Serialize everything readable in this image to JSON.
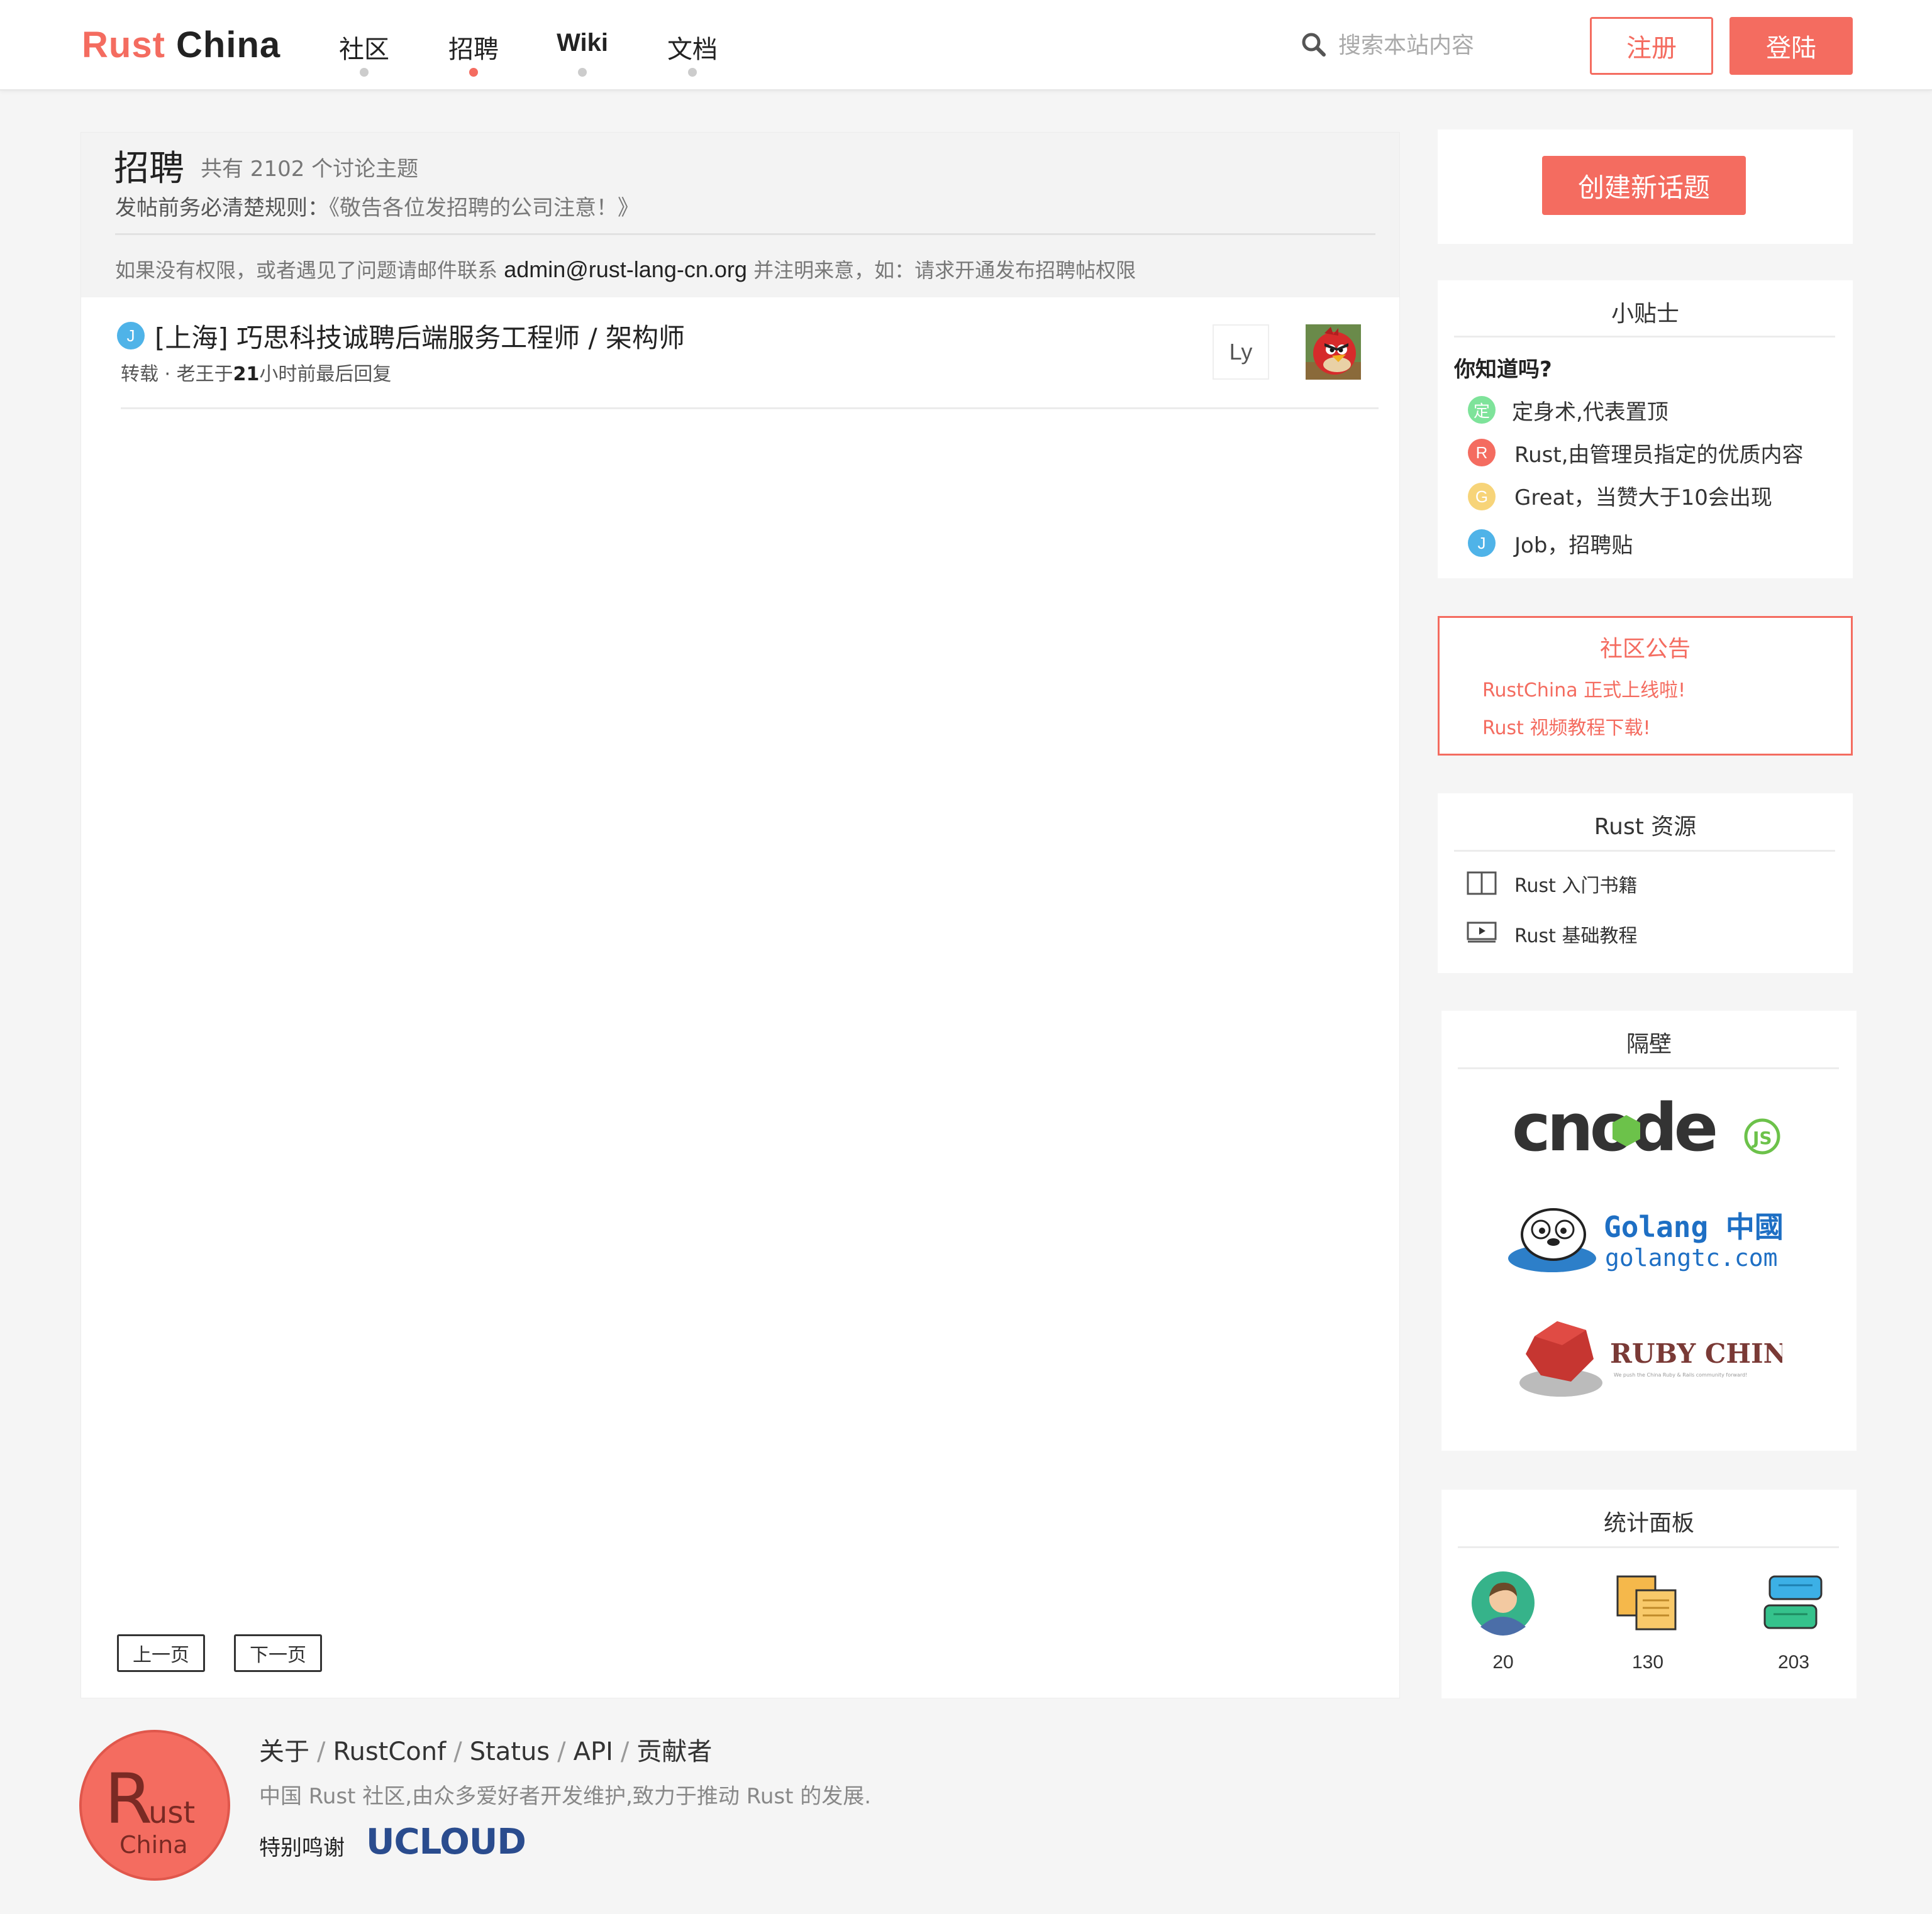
{
  "header": {
    "brand_part1": "Rust",
    "brand_part2": "China",
    "nav": [
      "社区",
      "招聘",
      "Wiki",
      "文档"
    ],
    "active_nav": "招聘",
    "search_placeholder": "搜索本站内容",
    "register_label": "注册",
    "login_label": "登陆"
  },
  "main": {
    "title": "招聘",
    "count_text": "共有 2102 个讨论主题",
    "rule_label": "发帖前务必清楚规则：",
    "rule_link": "《敬告各位发招聘的公司注意！》",
    "note_prefix": "如果没有权限，或者遇见了问题请邮件联系",
    "note_email": "admin@rust-lang-cn.org",
    "note_suffix": "并注明来意，如：请求开通发布招聘帖权限",
    "topics": [
      {
        "badge": "J",
        "title": "[上海] 巧思科技诚聘后端服务工程师 / 架构师",
        "tag": "转载",
        "meta_sep": " · ",
        "author": "老王于",
        "hours": "21",
        "time_suffix": "小时前最后回复",
        "reply_user": "Ly"
      }
    ],
    "prev_label": "上一页",
    "next_label": "下一页"
  },
  "sidebar": {
    "create_label": "创建新话题",
    "tips": {
      "title": "小贴士",
      "question": "你知道吗?",
      "items": [
        {
          "badge": "定",
          "text": "定身术,代表置顶",
          "color": "#7ee39a"
        },
        {
          "badge": "R",
          "text": "Rust,由管理员指定的优质内容",
          "color": "#f46c60"
        },
        {
          "badge": "G",
          "text": "Great，当赞大于10会出现",
          "color": "#f7d479"
        },
        {
          "badge": "J",
          "text": "Job，招聘贴",
          "color": "#4fb3e8"
        }
      ]
    },
    "notice": {
      "title": "社区公告",
      "items": [
        "RustChina 正式上线啦!",
        "Rust 视频教程下载!"
      ]
    },
    "resources": {
      "title": "Rust 资源",
      "items": [
        {
          "icon": "book-icon",
          "text": "Rust 入门书籍"
        },
        {
          "icon": "video-icon",
          "text": "Rust 基础教程"
        }
      ]
    },
    "neighbors": {
      "title": "隔壁",
      "cnode_text": "cnode",
      "cnode_js": "JS",
      "golang_title": "Golang 中國",
      "golang_domain": "golangtc.com",
      "ruby_title": "RUBY CHINA",
      "ruby_slogan": "We push the China Ruby & Rails community forward!"
    },
    "stats": {
      "title": "统计面板",
      "items": [
        {
          "icon": "user-icon",
          "value": "20"
        },
        {
          "icon": "documents-icon",
          "value": "130"
        },
        {
          "icon": "chat-icon",
          "value": "203"
        }
      ]
    }
  },
  "footer": {
    "logo_r": "R",
    "logo_ust": "ust",
    "logo_china": "China",
    "links": [
      "关于",
      "RustConf",
      "Status",
      "API",
      "贡献者"
    ],
    "link_sep": "/",
    "description": "中国 Rust 社区,由众多爱好者开发维护,致力于推动 Rust 的发展.",
    "thanks": "特别鸣谢",
    "sponsor": "UCLOUD"
  },
  "colors": {
    "accent": "#f46c60",
    "job_badge": "#4fb3e8"
  }
}
